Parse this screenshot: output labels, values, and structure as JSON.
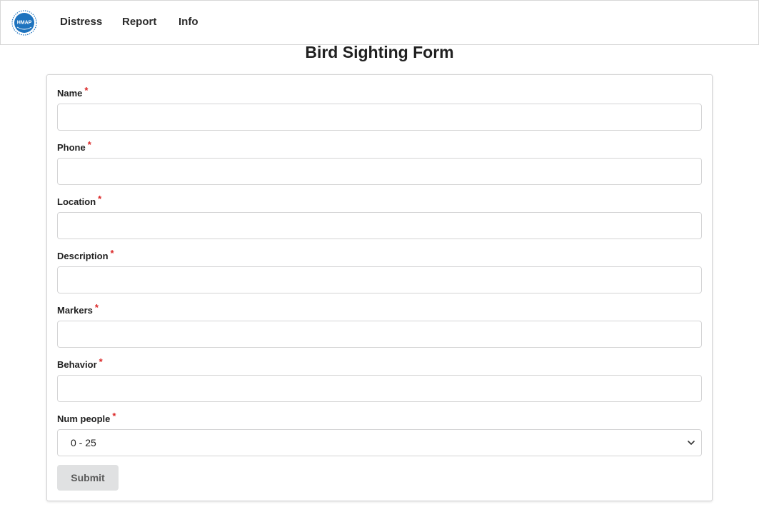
{
  "nav": {
    "logo_text": "HMAP",
    "links": [
      "Distress",
      "Report",
      "Info"
    ]
  },
  "form": {
    "title": "Bird Sighting Form",
    "required_marker": "*",
    "fields": [
      {
        "label": "Name",
        "value": ""
      },
      {
        "label": "Phone",
        "value": ""
      },
      {
        "label": "Location",
        "value": ""
      },
      {
        "label": "Description",
        "value": ""
      },
      {
        "label": "Markers",
        "value": ""
      },
      {
        "label": "Behavior",
        "value": ""
      }
    ],
    "num_people": {
      "label": "Num people",
      "selected": "0 - 25"
    },
    "submit_label": "Submit"
  },
  "colors": {
    "required": "#db2828",
    "logo_blue": "#1e73be",
    "button_bg": "#e0e1e2"
  }
}
